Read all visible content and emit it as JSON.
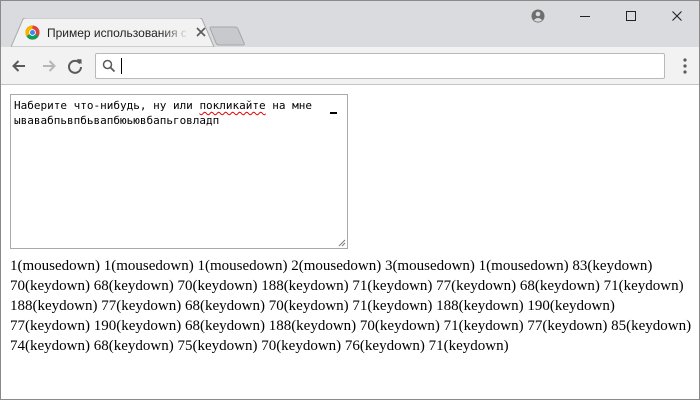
{
  "browser": {
    "tab": {
      "title": "Пример использования событий"
    },
    "address_bar": {
      "value": ""
    }
  },
  "icons": {
    "favicon": "chrome-favicon",
    "tab_close": "close-icon",
    "profile": "profile-icon",
    "back": "back-arrow-icon",
    "forward": "forward-arrow-icon",
    "reload": "reload-icon",
    "search": "search-icon",
    "menu": "kebab-menu-icon"
  },
  "page": {
    "textarea": {
      "line1_before": "Наберите что-нибудь, ну или ",
      "line1_misspelled": "покликайте",
      "line1_after": " на мне",
      "line2": "ывавабпьвпбьвапбюьювбапьговладп"
    },
    "event_log": "1(mousedown) 1(mousedown) 1(mousedown) 2(mousedown) 3(mousedown) 1(mousedown) 83(keydown) 70(keydown) 68(keydown) 70(keydown) 188(keydown) 71(keydown) 77(keydown) 68(keydown) 71(keydown) 188(keydown) 77(keydown) 68(keydown) 70(keydown) 71(keydown) 188(keydown) 190(keydown) 77(keydown) 190(keydown) 68(keydown) 188(keydown) 70(keydown) 71(keydown) 77(keydown) 85(keydown) 74(keydown) 68(keydown) 75(keydown) 70(keydown) 76(keydown) 71(keydown)"
  }
}
